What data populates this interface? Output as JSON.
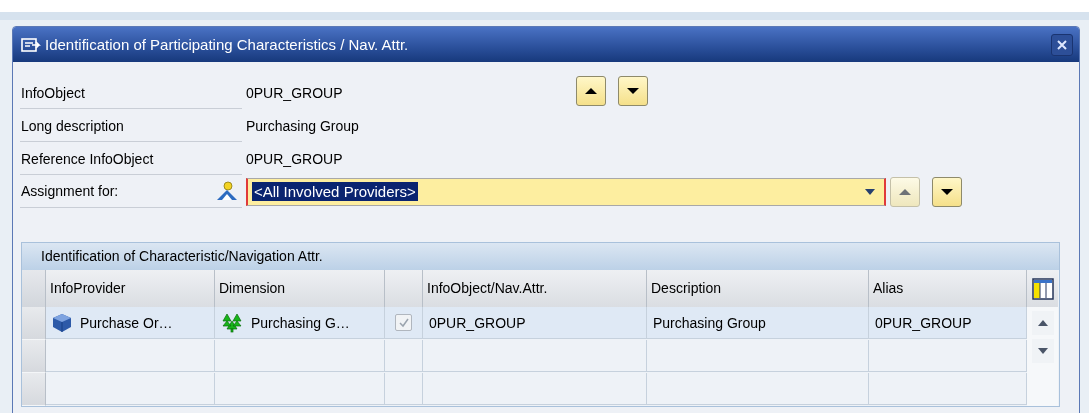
{
  "dialog": {
    "title": "Identification of Participating Characteristics / Nav. Attr.",
    "fields": [
      {
        "label": "InfoObject",
        "value": "0PUR_GROUP"
      },
      {
        "label": "Long description",
        "value": "Purchasing Group"
      },
      {
        "label": "Reference InfoObject",
        "value": "0PUR_GROUP"
      }
    ],
    "nav_buttons": [
      {
        "kind": "up",
        "disabled": false
      },
      {
        "kind": "down",
        "disabled": false
      }
    ],
    "assignment": {
      "label": "Assignment for:",
      "value": "<All Involved Providers>",
      "text_selected": true,
      "nav_buttons": [
        {
          "kind": "up",
          "disabled": true
        },
        {
          "kind": "down",
          "disabled": false
        }
      ]
    },
    "table": {
      "title": "Identification of Characteristic/Navigation Attr.",
      "columns": [
        "InfoProvider",
        "Dimension",
        "",
        "InfoObject/Nav.Attr.",
        "Description",
        "Alias"
      ],
      "rows": [
        {
          "info_provider": "Purchase Or…",
          "dimension": "Purchasing G…",
          "checked": true,
          "infoobject": "0PUR_GROUP",
          "description": "Purchasing Group",
          "alias": "0PUR_GROUP"
        }
      ]
    }
  }
}
